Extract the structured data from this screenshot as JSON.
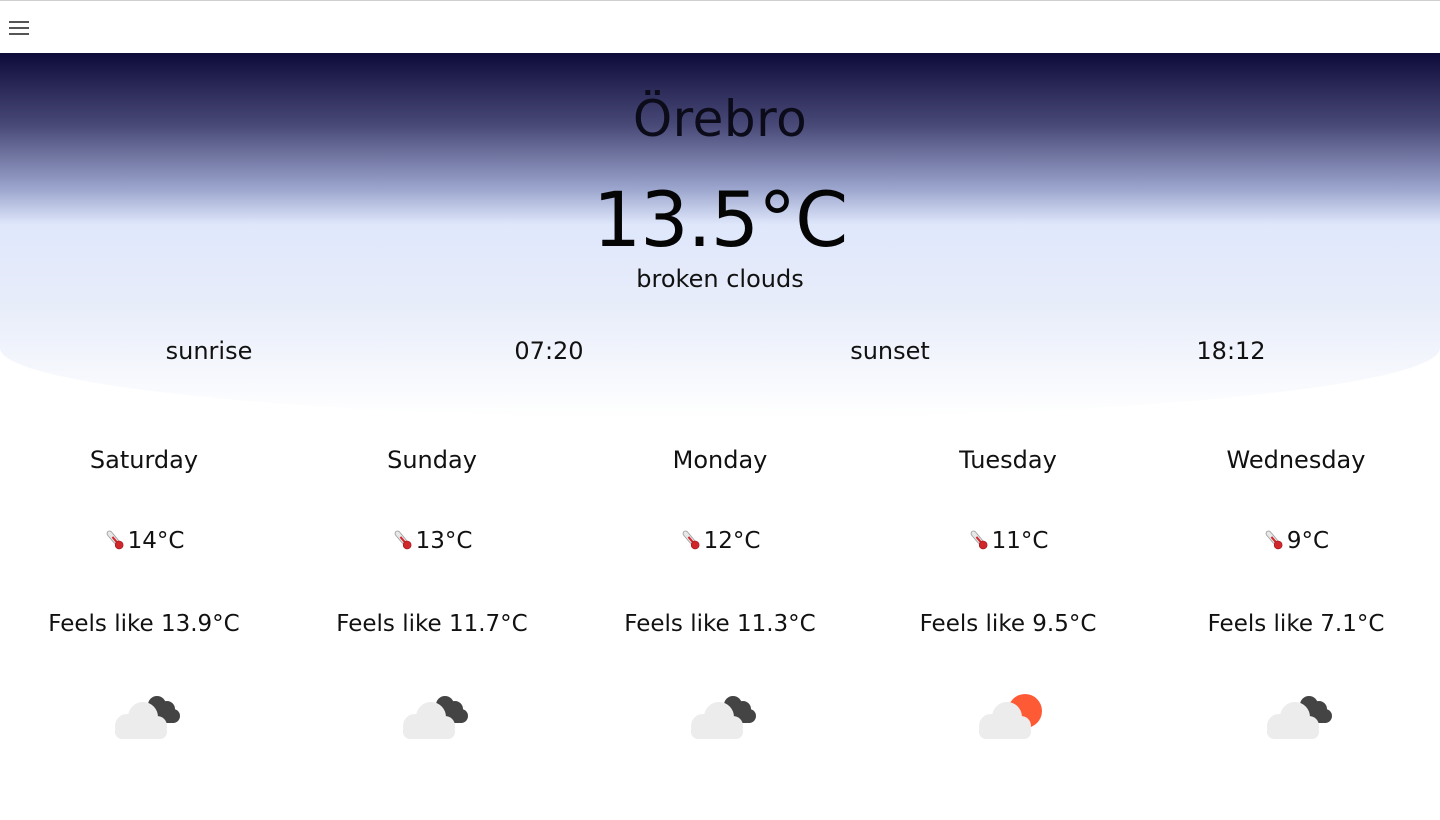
{
  "topbar": {
    "menu_icon": "hamburger-menu-icon"
  },
  "current": {
    "city": "Örebro",
    "temperature": "13.5°C",
    "description": "broken clouds",
    "sunrise_label": "sunrise",
    "sunrise_time": "07:20",
    "sunset_label": "sunset",
    "sunset_time": "18:12"
  },
  "colors": {
    "gradient_top": "#0d0b3a",
    "gradient_bottom": "#ffffff",
    "cloud_light": "#ececec",
    "cloud_dark": "#444444",
    "sun": "#ff5a36"
  },
  "forecast": [
    {
      "day": "Saturday",
      "temp": "14°C",
      "feels": "Feels like 13.9°C",
      "icon": "cloud-dark-icon"
    },
    {
      "day": "Sunday",
      "temp": "13°C",
      "feels": "Feels like 11.7°C",
      "icon": "cloud-dark-icon"
    },
    {
      "day": "Monday",
      "temp": "12°C",
      "feels": "Feels like 11.3°C",
      "icon": "cloud-dark-icon"
    },
    {
      "day": "Tuesday",
      "temp": "11°C",
      "feels": "Feels like 9.5°C",
      "icon": "cloud-sun-icon"
    },
    {
      "day": "Wednesday",
      "temp": "9°C",
      "feels": "Feels like 7.1°C",
      "icon": "cloud-dark-icon"
    }
  ]
}
